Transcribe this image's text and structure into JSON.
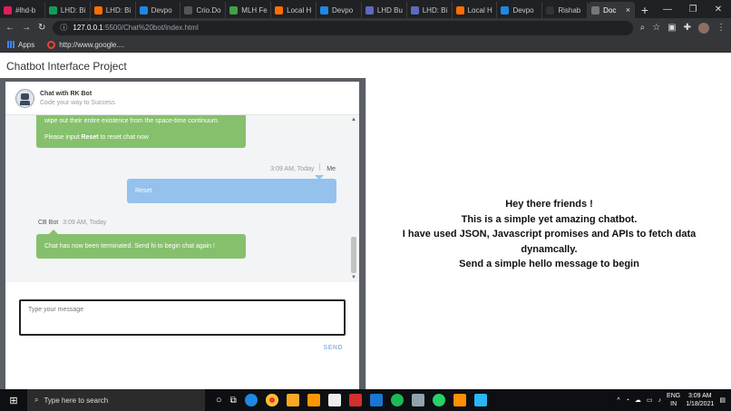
{
  "browser": {
    "tabs": [
      {
        "label": "#lhd-b",
        "color": "#e01e5a",
        "icon": "slack-icon"
      },
      {
        "label": "LHD: Bi",
        "color": "#0f9d58",
        "icon": "sheets-icon"
      },
      {
        "label": "LHD: Bi",
        "color": "#ff6f00",
        "icon": "postman-icon"
      },
      {
        "label": "Devpo",
        "color": "#1e88e5",
        "icon": "devpost-icon"
      },
      {
        "label": "Crio.Do",
        "color": "#555555",
        "icon": "crio-icon"
      },
      {
        "label": "MLH Fe",
        "color": "#43a047",
        "icon": "mlh-icon"
      },
      {
        "label": "Local H",
        "color": "#ff6f00",
        "icon": "postman-icon"
      },
      {
        "label": "Devpo",
        "color": "#1e88e5",
        "icon": "devpost-icon"
      },
      {
        "label": "LHD Bu",
        "color": "#5c6bc0",
        "icon": "forms-icon"
      },
      {
        "label": "LHD: Bi",
        "color": "#5c6bc0",
        "icon": "forms-icon"
      },
      {
        "label": "Local H",
        "color": "#ff6f00",
        "icon": "postman-icon"
      },
      {
        "label": "Devpo",
        "color": "#1e88e5",
        "icon": "devpost-icon"
      },
      {
        "label": "Rishab",
        "color": "#333333",
        "icon": "github-icon"
      },
      {
        "label": "Doc",
        "color": "#777777",
        "icon": "loading-icon",
        "active": true
      }
    ],
    "new_tab": "+",
    "url_host": "127.0.0.1",
    "url_path": ":5500/Chat%20bot/index.html",
    "bookmarks": [
      {
        "label": "Apps",
        "icon": "apps-grid-icon"
      },
      {
        "label": "http://www.google....",
        "icon": "google-icon"
      }
    ]
  },
  "page": {
    "title": "Chatbot Interface Project",
    "chat": {
      "bot_name": "Chat with RK Bot",
      "bot_tagline": "Code your way to Success",
      "messages": {
        "bot1_line1": "wipe out their entire existence from the space-time continuum.",
        "bot1_line2_pre": "Please input ",
        "bot1_line2_bold": "Reset",
        "bot1_line2_post": " to reset chat now",
        "user_time": "3:09 AM, Today",
        "user_who": "Me",
        "user_text": "Reset",
        "bot2_who": "CB Bot",
        "bot2_time": "3:09 AM, Today",
        "bot2_text": "Chat has now been terminated. Send hi to begin chat again !"
      },
      "input_placeholder": "Type your message",
      "send_label": "SEND"
    },
    "welcome": {
      "line1": "Hey there friends !",
      "line2": "This is a simple yet amazing chatbot.",
      "line3": "I have used JSON, Javascript promises and APIs to fetch data",
      "line4": "dynamcally.",
      "line5": "Send a simple hello message to begin"
    }
  },
  "taskbar": {
    "search_placeholder": "Type here to search",
    "lang_line1": "ENG",
    "lang_line2": "IN",
    "time": "3:09 AM",
    "date": "1/18/2021"
  }
}
